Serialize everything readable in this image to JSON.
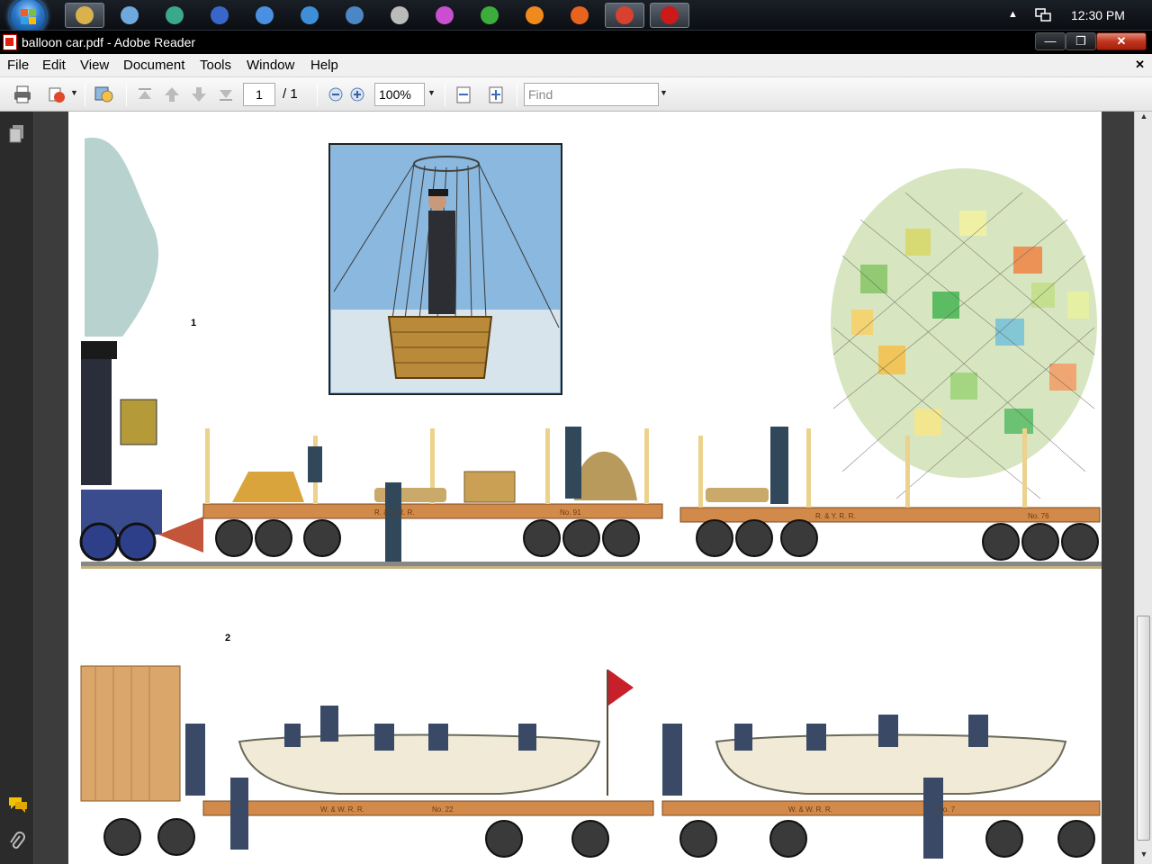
{
  "taskbar": {
    "clock": "12:30 PM",
    "apps": [
      {
        "name": "file-explorer-icon",
        "color": "#d9b24c"
      },
      {
        "name": "drive-icon",
        "color": "#6fa8dc"
      },
      {
        "name": "globe-app-icon",
        "color": "#3aa88a"
      },
      {
        "name": "google-earth-icon",
        "color": "#3967c9"
      },
      {
        "name": "itunes-icon",
        "color": "#4a90e2"
      },
      {
        "name": "bird-app-icon",
        "color": "#3f8fd8"
      },
      {
        "name": "cube-app-icon",
        "color": "#4b86c5"
      },
      {
        "name": "gear-app-icon",
        "color": "#bbbbbb"
      },
      {
        "name": "color-wheel-icon",
        "color": "#c94fd0"
      },
      {
        "name": "utorrent-icon",
        "color": "#3cad3c"
      },
      {
        "name": "vlc-icon",
        "color": "#f08a1c"
      },
      {
        "name": "firefox-icon",
        "color": "#e8631e"
      },
      {
        "name": "chrome-icon",
        "color": "#d8402f"
      },
      {
        "name": "adobe-reader-icon",
        "color": "#cc1a1a"
      }
    ]
  },
  "window": {
    "title": "balloon car.pdf - Adobe Reader",
    "minimize": "—",
    "maximize": "❐",
    "close": "✕"
  },
  "menu": {
    "items": [
      "File",
      "Edit",
      "View",
      "Document",
      "Tools",
      "Window",
      "Help"
    ],
    "doc_close": "✕"
  },
  "toolbar": {
    "page_current": "1",
    "page_total": "/ 1",
    "zoom": "100%",
    "find_placeholder": "Find"
  },
  "document": {
    "figure1_label": "1",
    "figure2_label": "2",
    "car_markings": [
      "R. & Y. R. R.",
      "No. 91",
      "R. & Y. R. R.",
      "No. 76",
      "W. & W. R. R.",
      "No. 22",
      "W. & W. R. R.",
      "No. 7"
    ]
  },
  "colors": {
    "accent": "#cc1a1a",
    "taskbar": "#11151a"
  }
}
